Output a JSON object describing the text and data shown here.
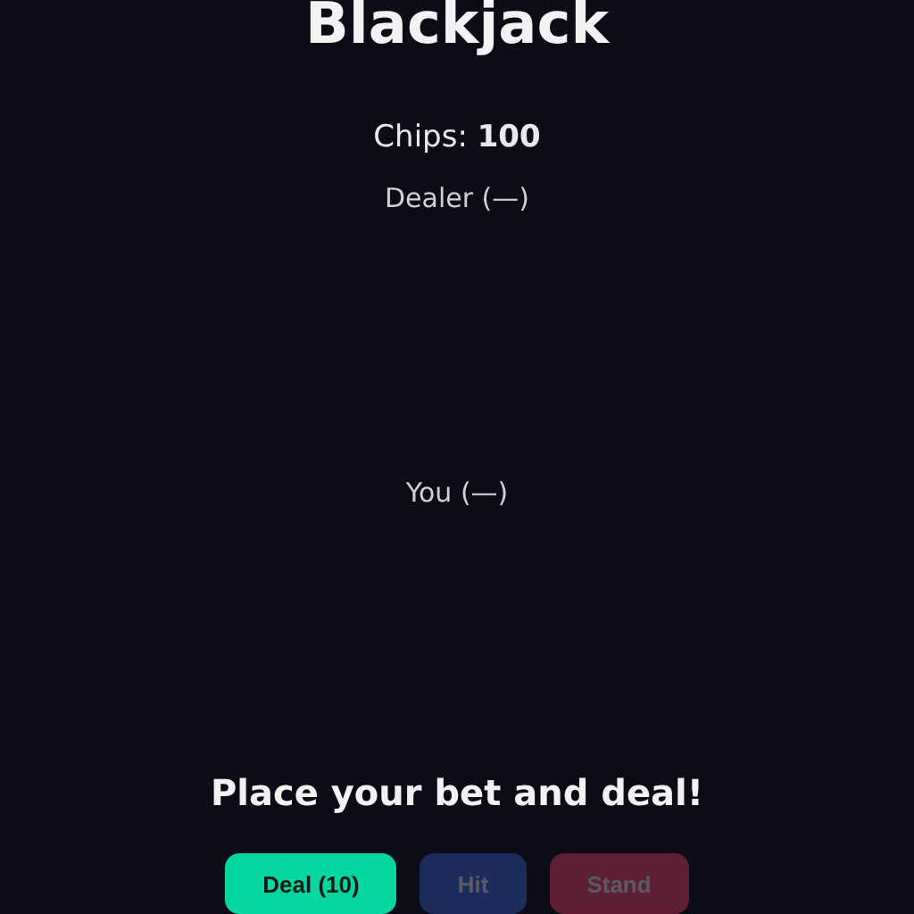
{
  "title": "Blackjack",
  "chips": "Chips: **100**",
  "dealer": {
    "label": "Dealer (—)"
  },
  "player": {
    "label": "You (—)"
  },
  "message": "Place your bet and deal!",
  "buttons": [
    {
      "label": "Deal (10)",
      "kind": "deal",
      "disabled": false
    },
    {
      "label": "Hit",
      "kind": "hit",
      "disabled": true
    },
    {
      "label": "Stand",
      "kind": "stand",
      "disabled": true
    }
  ]
}
